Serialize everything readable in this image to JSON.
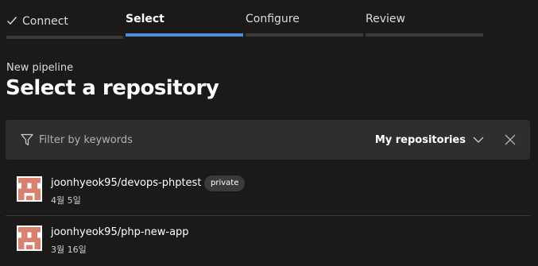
{
  "wizard": {
    "steps": [
      {
        "label": "Connect",
        "state": "completed",
        "icon": "check-icon"
      },
      {
        "label": "Select",
        "state": "active"
      },
      {
        "label": "Configure",
        "state": "pending"
      },
      {
        "label": "Review",
        "state": "pending"
      }
    ]
  },
  "header": {
    "subtitle": "New pipeline",
    "title": "Select a repository"
  },
  "filter": {
    "placeholder": "Filter by keywords",
    "value": "",
    "icon": "filter-icon",
    "scope_label": "My repositories",
    "scope_icon": "chevron-down-icon",
    "clear_icon": "close-icon"
  },
  "repositories": [
    {
      "name": "joonhyeok95/devops-phptest",
      "badge": "private",
      "date": "4월 5일",
      "avatar_icon": "identicon-avatar"
    },
    {
      "name": "joonhyeok95/php-new-app",
      "date": "3월 16일",
      "avatar_icon": "identicon-avatar"
    }
  ],
  "colors": {
    "background": "#1b1a19",
    "panel": "#2f2e2d",
    "accent": "#4f8fd6",
    "step_bar": "#3b3a39",
    "avatar": "#d9806e"
  }
}
